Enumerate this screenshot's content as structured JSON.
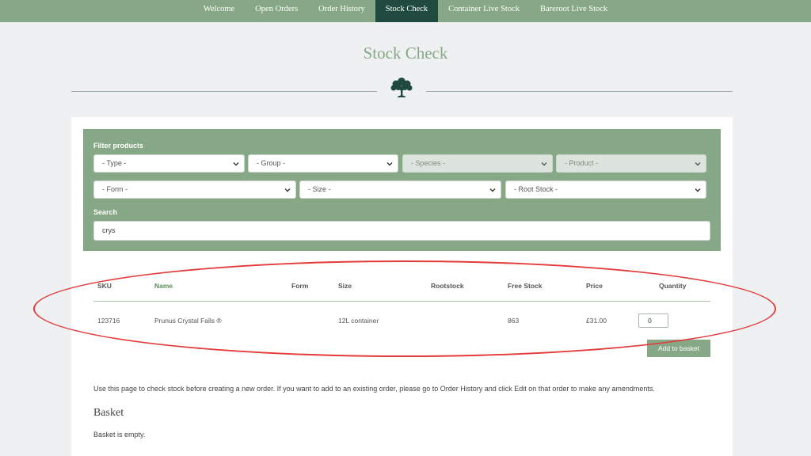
{
  "nav": {
    "items": [
      {
        "label": "Welcome"
      },
      {
        "label": "Open Orders"
      },
      {
        "label": "Order History"
      },
      {
        "label": "Stock Check",
        "active": true
      },
      {
        "label": "Container Live Stock"
      },
      {
        "label": "Bareroot Live Stock"
      }
    ]
  },
  "page": {
    "title": "Stock Check"
  },
  "filters": {
    "heading": "Filter products",
    "type": "- Type -",
    "group": "- Group -",
    "species": "- Species -",
    "product": "- Product -",
    "form": "- Form -",
    "size": "- Size -",
    "root_stock": "- Root Stock -",
    "search_label": "Search",
    "search_value": "crys"
  },
  "table": {
    "headers": [
      "SKU",
      "Name",
      "Form",
      "Size",
      "Rootstock",
      "Free Stock",
      "Price",
      "Quantity"
    ],
    "rows": [
      {
        "sku": "123716",
        "name": "Prunus Crystal Falls ®",
        "form": "",
        "size": "12L container",
        "rootstock": "",
        "free_stock": "863",
        "price": "£31.00",
        "quantity": "0"
      }
    ],
    "add_button": "Add to basket"
  },
  "help_text": "Use this page to check stock before creating a new order. If you want to add to an existing order, please go to Order History and click Edit on that order to make any amendments.",
  "basket": {
    "title": "Basket",
    "empty_text": "Basket is empty."
  },
  "colors": {
    "nav_bg": "#87a886",
    "nav_active": "#1f4a3d",
    "accent": "#87a886",
    "highlight": "#e33a3a"
  }
}
